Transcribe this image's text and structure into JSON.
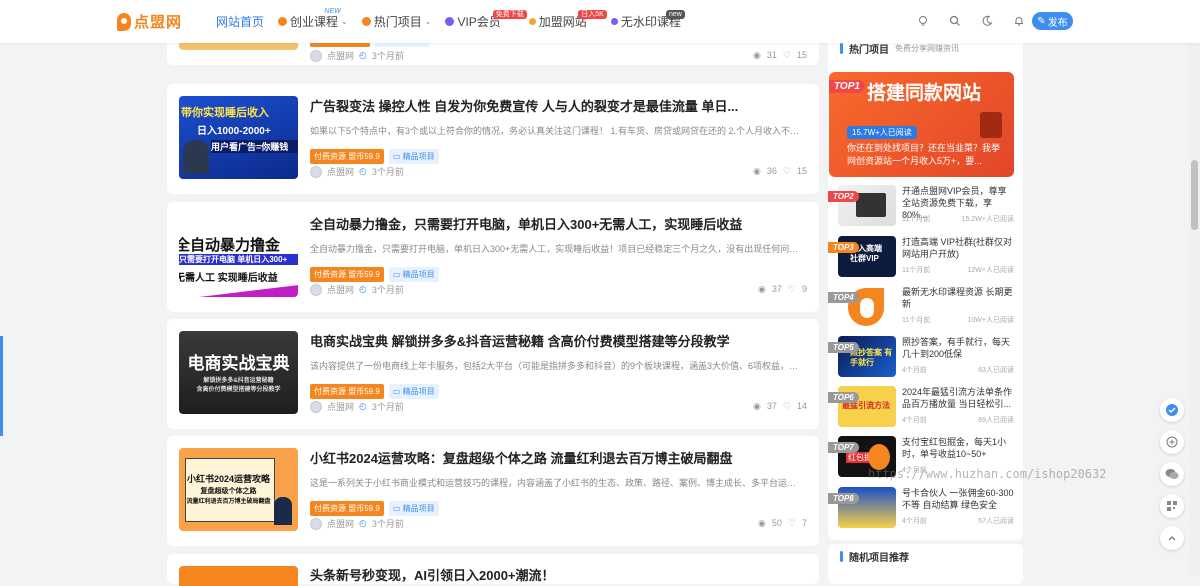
{
  "header": {
    "logo_text": "点盟网",
    "nav": [
      {
        "label": "网站首页",
        "active": true
      },
      {
        "label": "创业课程",
        "badge": "NEW",
        "badge_color": "#3d8ef0",
        "icon_color": "#f5851f",
        "caret": "⌄"
      },
      {
        "label": "热门项目",
        "icon_color": "#f5851f",
        "caret": "⌄"
      },
      {
        "label": "VIP会员",
        "badge": "免费下载",
        "badge_color": "#f04848",
        "icon_color": "#7a5cf0"
      },
      {
        "label": "加盟网站",
        "badge": "日入5K",
        "badge_color": "#f04848",
        "icon_color": "#f5a623"
      },
      {
        "label": "无水印课程",
        "badge": "new",
        "badge_color": "#555",
        "icon_color": "#7a5cf0"
      }
    ],
    "publish_label": "发布"
  },
  "posts": [
    {
      "title": "",
      "excerpt": "",
      "price_tag": "",
      "cat_tag": "",
      "author": "点盟网",
      "time": "3个月前",
      "views": "31",
      "likes": "15"
    },
    {
      "title": "广告裂变法 操控人性 自发为你免费宣传 人与人的裂变才是最佳流量 单日...",
      "excerpt": "如果以下5个特点中，有3个或以上符合你的情况，务必认真关注这门课程！ 1.有车货、房贷或网贷在还的 2.个人月收入不超过...",
      "price_tag": "付费资源 盟币59.9",
      "cat_tag": "精品项目",
      "author": "点盟网",
      "time": "3个月前",
      "views": "36",
      "likes": "15",
      "thumb_lines": [
        "带你实现睡后收入",
        "日入1000-2000+",
        "用户看广告=你赚钱"
      ]
    },
    {
      "title": "全自动暴力撸金，只需要打开电脑，单机日入300+无需人工，实现睡后收益",
      "excerpt": "全自动暴力撸金，只需要打开电脑，单机日入300+无需人工，实现睡后收益！项目已经稳定三个月之久，没有出现任何问题，非...",
      "price_tag": "付费资源 盟币59.9",
      "cat_tag": "精品项目",
      "author": "点盟网",
      "time": "3个月前",
      "views": "37",
      "likes": "9",
      "thumb_lines": [
        "全自动暴力撸金",
        "只需要打开电脑 单机日入300+",
        "无需人工 实现睡后收益"
      ]
    },
    {
      "title": "电商实战宝典 解锁拼多多&抖音运营秘籍 含高价付费模型搭建等分段教学",
      "excerpt": "该内容提供了一份电商线上年卡服务，包括2大平台（可能是指拼多多和抖音）的9个板块课程，涵盖3大价值、6项权益，共有...",
      "price_tag": "付费资源 盟币59.9",
      "cat_tag": "精品项目",
      "author": "点盟网",
      "time": "3个月前",
      "views": "37",
      "likes": "14",
      "thumb_lines": [
        "电商实战宝典",
        "解锁拼多多&抖音运营秘籍",
        "含高价付费模型搭建等分段教学"
      ]
    },
    {
      "title": "小红书2024运营攻略：复盘超级个体之路 流量红利退去百万博主破局翻盘",
      "excerpt": "这是一系列关于小红书商业模式和运营技巧的课程，内容涵盖了小红书的生态、政策、路径、案例、博主成长、多平台运营、...",
      "price_tag": "付费资源 盟币59.9",
      "cat_tag": "精品项目",
      "author": "点盟网",
      "time": "3个月前",
      "views": "50",
      "likes": "7",
      "thumb_lines": [
        "小红书2024运营攻略",
        "复盘超级个体之路",
        "流量红利退去百万博主破局翻盘"
      ]
    },
    {
      "title": "头条新号秒变现，AI引领日入2000+潮流！"
    }
  ],
  "sidebar": {
    "hot_title": "热门项目",
    "hot_sub": "免费分享网赚资讯",
    "top1": {
      "badge": "TOP1",
      "big": "搭建同款网站",
      "pill": "15.7W+人已阅读",
      "caption": "你还在到处找项目？还在当韭菜？我挙网创资源站一个月收入5万+，要..."
    },
    "items": [
      {
        "badge": "TOP2",
        "title": "开通点盟网VIP会员，尊享全站资源免费下载，享80%...",
        "time": "11个月前",
        "reads": "15.2W+人已阅读"
      },
      {
        "badge": "TOP3",
        "title": "打造高端 VIP社群(社群仅对网站用户开放)",
        "time": "11个月前",
        "reads": "12W+人已阅读",
        "thumb": "加入高端 社群VIP"
      },
      {
        "badge": "TOP4",
        "title": "最新无水印课程资源 长期更新",
        "time": "11个月前",
        "reads": "10W+人已阅读"
      },
      {
        "badge": "TOP5",
        "title": "照抄答案，有手就行，每天几十到200低保",
        "time": "4个月前",
        "reads": "63人已阅读",
        "thumb": "照抄答案 有手就行"
      },
      {
        "badge": "TOP6",
        "title": "2024年最猛引流方法单条作品百万播放量 当日轻松引...",
        "time": "4个月前",
        "reads": "69人已阅读",
        "thumb": "最猛引流方法"
      },
      {
        "badge": "TOP7",
        "title": "支付宝红包掘金，每天1小时，单号收益10~50+",
        "time": "4个月前",
        "reads": "",
        "thumb": "红包掘金"
      },
      {
        "badge": "TOP8",
        "title": "号卡合伙人 一张佣金60-300不等 自动结算 绿色安全",
        "time": "4个月前",
        "reads": "57人已阅读"
      }
    ],
    "random_title": "随机项目推荐"
  },
  "watermark": "https://www.huzhan.com/ishop20632",
  "colors": {
    "accent": "#3d8ef0",
    "orange": "#f5851f"
  }
}
